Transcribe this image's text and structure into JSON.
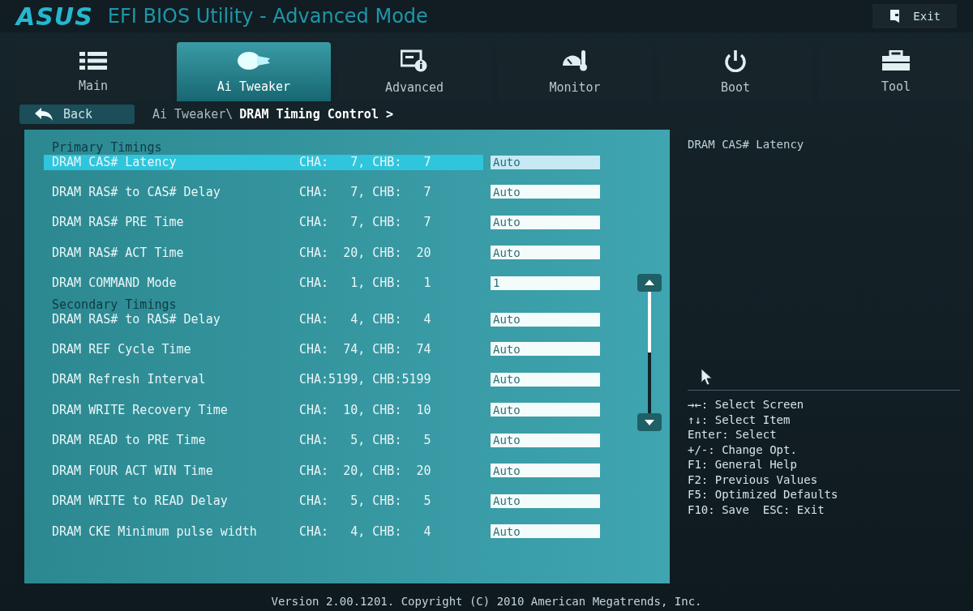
{
  "header": {
    "logo": "ASUS",
    "title": "EFI BIOS Utility - Advanced Mode",
    "exit_label": "Exit"
  },
  "tabs": [
    {
      "label": "Main",
      "kind": "list",
      "selected": false
    },
    {
      "label": "Ai Tweaker",
      "kind": "tweaker",
      "selected": true
    },
    {
      "label": "Advanced",
      "kind": "advanced",
      "selected": false
    },
    {
      "label": "Monitor",
      "kind": "monitor",
      "selected": false
    },
    {
      "label": "Boot",
      "kind": "power",
      "selected": false
    },
    {
      "label": "Tool",
      "kind": "tool",
      "selected": false
    }
  ],
  "nav": {
    "back_label": "Back",
    "breadcrumb_parent": "Ai Tweaker\\",
    "breadcrumb_current": "DRAM Timing Control >"
  },
  "sections": [
    {
      "title": "Primary Timings",
      "rows": [
        {
          "label": "DRAM CAS# Latency",
          "reading": "CHA:   7, CHB:   7",
          "value": "Auto",
          "selected": true
        },
        {
          "label": "DRAM RAS# to CAS# Delay",
          "reading": "CHA:   7, CHB:   7",
          "value": "Auto",
          "selected": false
        },
        {
          "label": "DRAM RAS# PRE Time",
          "reading": "CHA:   7, CHB:   7",
          "value": "Auto",
          "selected": false
        },
        {
          "label": "DRAM RAS# ACT Time",
          "reading": "CHA:  20, CHB:  20",
          "value": "Auto",
          "selected": false
        },
        {
          "label": "DRAM COMMAND Mode",
          "reading": "CHA:   1, CHB:   1",
          "value": "1",
          "selected": false
        }
      ]
    },
    {
      "title": "Secondary Timings",
      "rows": [
        {
          "label": "DRAM RAS# to RAS# Delay",
          "reading": "CHA:   4, CHB:   4",
          "value": "Auto",
          "selected": false
        },
        {
          "label": "DRAM REF Cycle Time",
          "reading": "CHA:  74, CHB:  74",
          "value": "Auto",
          "selected": false
        },
        {
          "label": "DRAM Refresh Interval",
          "reading": "CHA:5199, CHB:5199",
          "value": "Auto",
          "selected": false
        },
        {
          "label": "DRAM WRITE Recovery Time",
          "reading": "CHA:  10, CHB:  10",
          "value": "Auto",
          "selected": false
        },
        {
          "label": "DRAM READ to PRE Time",
          "reading": "CHA:   5, CHB:   5",
          "value": "Auto",
          "selected": false
        },
        {
          "label": "DRAM FOUR ACT WIN Time",
          "reading": "CHA:  20, CHB:  20",
          "value": "Auto",
          "selected": false
        },
        {
          "label": "DRAM WRITE to READ Delay",
          "reading": "CHA:   5, CHB:   5",
          "value": "Auto",
          "selected": false
        },
        {
          "label": "DRAM CKE Minimum pulse width",
          "reading": "CHA:   4, CHB:   4",
          "value": "Auto",
          "selected": false
        }
      ]
    }
  ],
  "help": {
    "description": "DRAM CAS# Latency",
    "keys": [
      "→←: Select Screen",
      "↑↓: Select Item",
      "Enter: Select",
      "+/-: Change Opt.",
      "F1: General Help",
      "F2: Previous Values",
      "F5: Optimized Defaults",
      "F10: Save  ESC: Exit"
    ]
  },
  "footer": "Version 2.00.1201. Copyright (C) 2010 American Megatrends, Inc."
}
